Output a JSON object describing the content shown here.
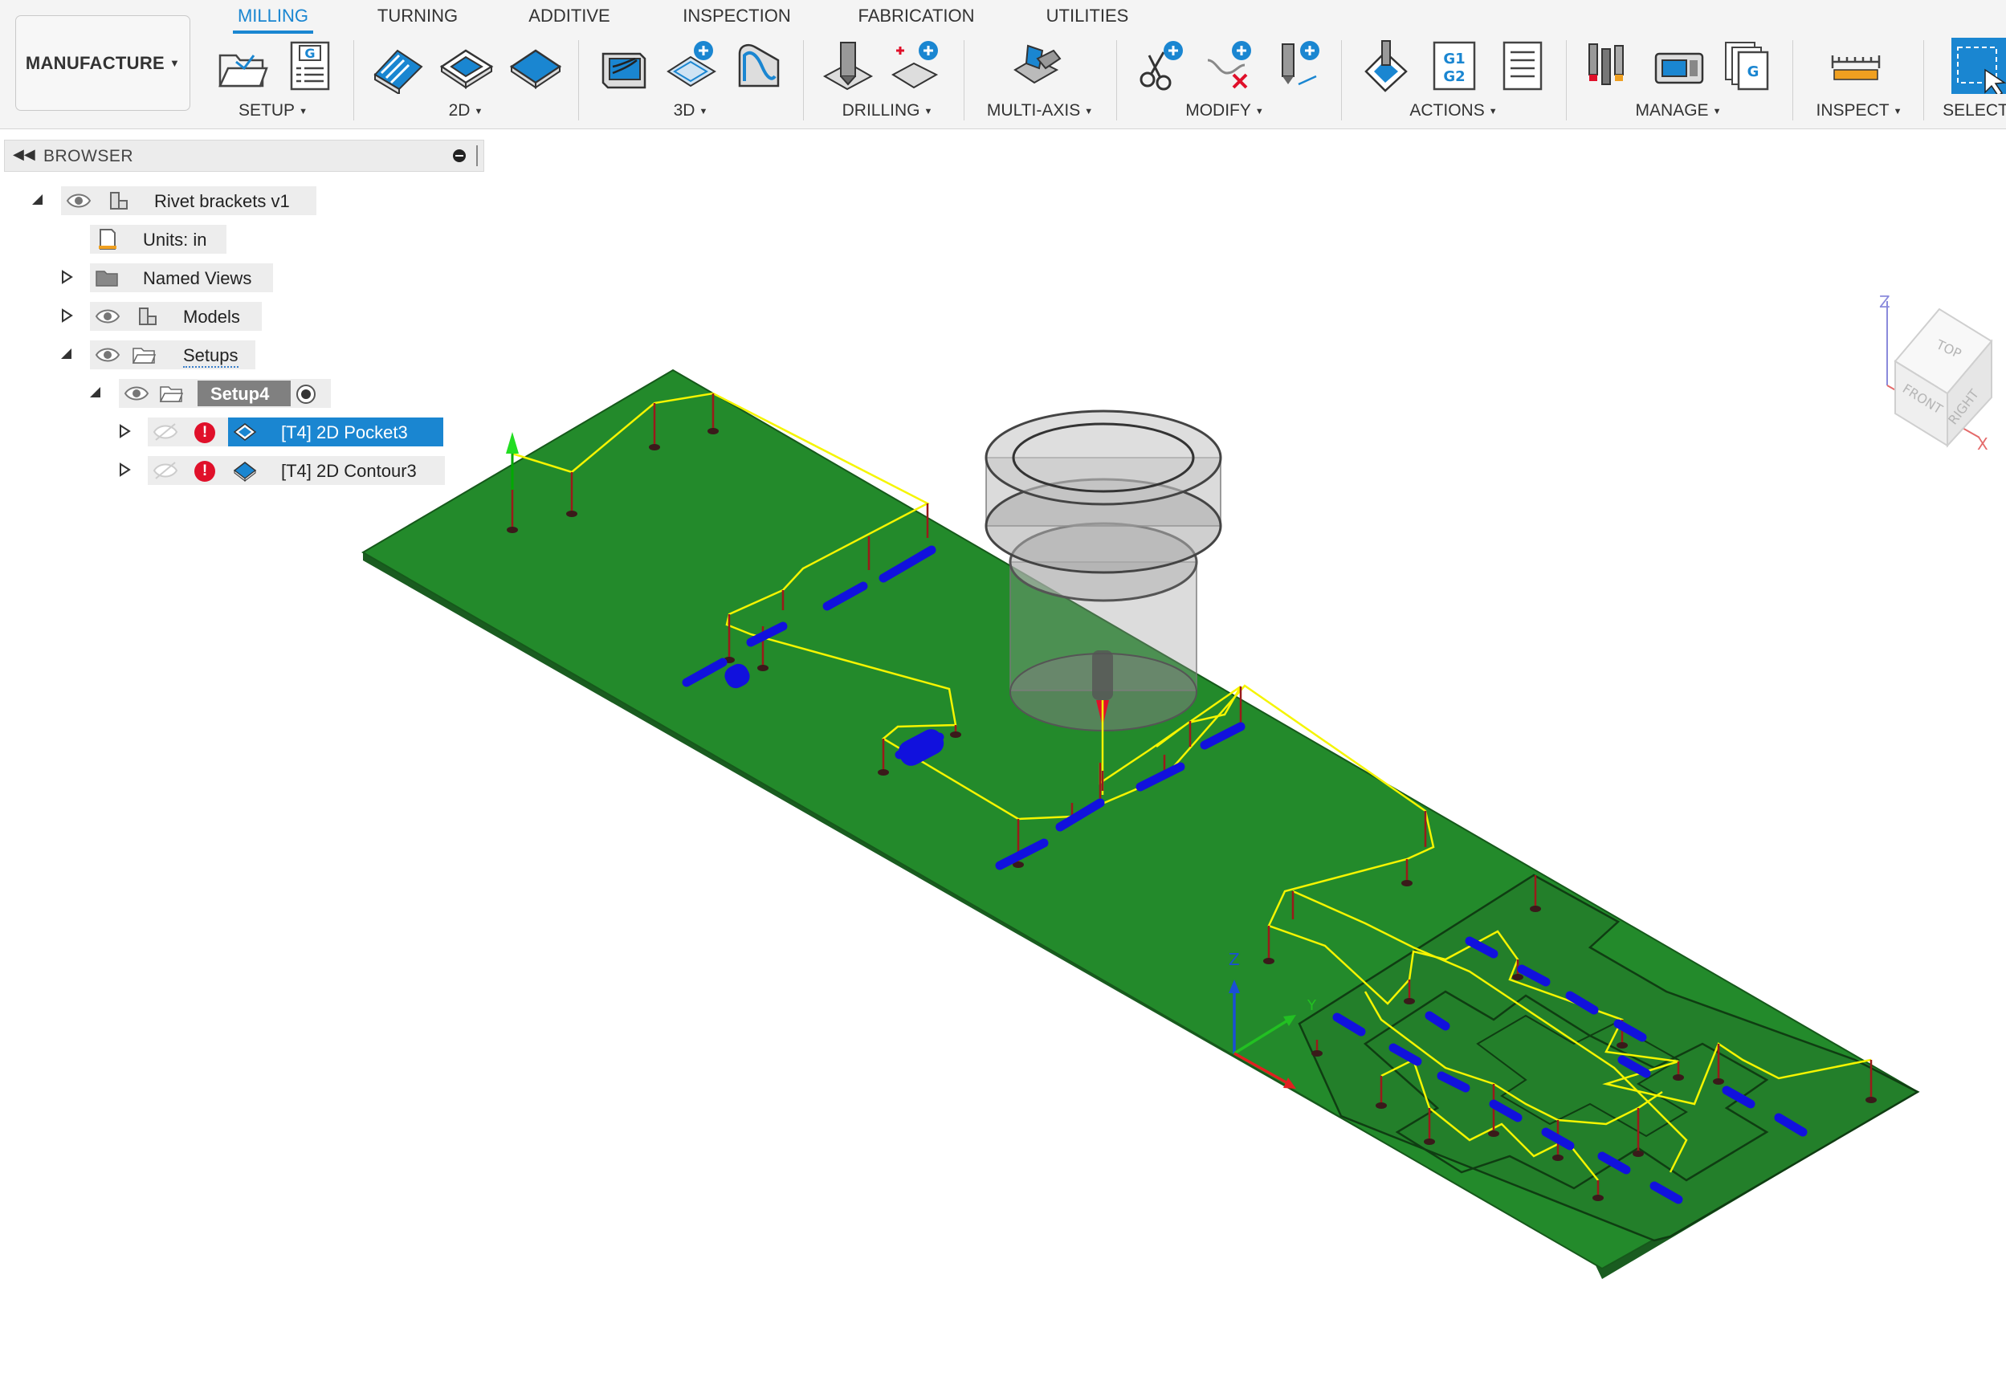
{
  "workspace": {
    "label": "MANUFACTURE"
  },
  "tabs": [
    {
      "label": "MILLING",
      "active": true
    },
    {
      "label": "TURNING"
    },
    {
      "label": "ADDITIVE"
    },
    {
      "label": "INSPECTION"
    },
    {
      "label": "FABRICATION"
    },
    {
      "label": "UTILITIES"
    }
  ],
  "ribbon_groups": [
    {
      "label": "SETUP"
    },
    {
      "label": "2D"
    },
    {
      "label": "3D"
    },
    {
      "label": "DRILLING"
    },
    {
      "label": "MULTI-AXIS"
    },
    {
      "label": "MODIFY"
    },
    {
      "label": "ACTIONS"
    },
    {
      "label": "MANAGE"
    },
    {
      "label": "INSPECT"
    },
    {
      "label": "SELECT"
    }
  ],
  "tool_icons": {
    "post_process_top": "G1",
    "post_process_bottom": "G2",
    "nc_program": "G",
    "setup_sheet": "G"
  },
  "browser": {
    "title": "BROWSER",
    "root": "Rivet brackets v1",
    "units": "Units: in",
    "named_views": "Named Views",
    "models": "Models",
    "setups": "Setups",
    "setup": "Setup4",
    "operations": [
      {
        "label": "[T4] 2D Pocket3",
        "selected": true,
        "warning": true
      },
      {
        "label": "[T4] 2D Contour3",
        "selected": false,
        "warning": true
      }
    ]
  },
  "viewcube": {
    "top": "TOP",
    "front": "FRONT",
    "right": "RIGHT",
    "axis_z": "Z",
    "axis_x": "X"
  },
  "triad": {
    "z": "Z",
    "y": "Y"
  },
  "colors": {
    "accent": "#1a86d1",
    "stock": "#228a2b",
    "toolpath_rapid": "#f5f500",
    "cut_pass": "#1111dd",
    "warning": "#e0102a"
  }
}
